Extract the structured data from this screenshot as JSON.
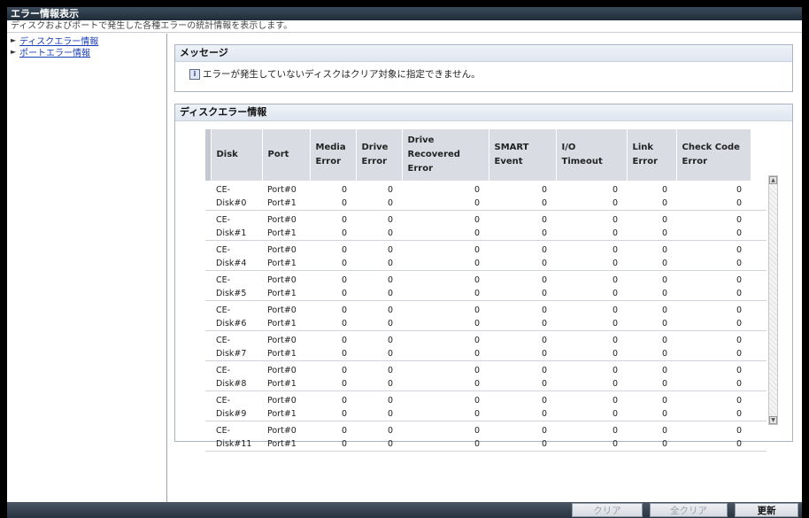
{
  "window": {
    "title": "エラー情報表示",
    "subtitle": "ディスクおよびポートで発生した各種エラーの統計情報を表示します。"
  },
  "sidebar": {
    "items": [
      {
        "label": "ディスクエラー情報"
      },
      {
        "label": "ポートエラー情報"
      }
    ]
  },
  "message_panel": {
    "title": "メッセージ",
    "text": "エラーが発生していないディスクはクリア対象に指定できません。",
    "icon": "info-icon"
  },
  "disk_panel": {
    "title": "ディスクエラー情報",
    "columns": {
      "disk": "Disk",
      "port": "Port",
      "media_error_1": "Media",
      "media_error_2": "Error",
      "drive_error_1": "Drive",
      "drive_error_2": "Error",
      "drive_recovered_1": "Drive",
      "drive_recovered_2": "Recovered",
      "drive_recovered_3": "Error",
      "smart_event_1": "SMART",
      "smart_event_2": "Event",
      "io_timeout_1": "I/O",
      "io_timeout_2": "Timeout",
      "link_error_1": "Link",
      "link_error_2": "Error",
      "check_code_1": "Check Code",
      "check_code_2": "Error"
    },
    "rows": [
      {
        "disk1": "CE-",
        "disk2": "Disk#0",
        "p1": "Port#0",
        "p2": "Port#1",
        "a": [
          "0",
          "0",
          "0",
          "0",
          "0",
          "0",
          "0"
        ],
        "b": [
          "0",
          "0",
          "0",
          "0",
          "0",
          "0",
          "0"
        ]
      },
      {
        "disk1": "CE-",
        "disk2": "Disk#1",
        "p1": "Port#0",
        "p2": "Port#1",
        "a": [
          "0",
          "0",
          "0",
          "0",
          "0",
          "0",
          "0"
        ],
        "b": [
          "0",
          "0",
          "0",
          "0",
          "0",
          "0",
          "0"
        ]
      },
      {
        "disk1": "CE-",
        "disk2": "Disk#4",
        "p1": "Port#0",
        "p2": "Port#1",
        "a": [
          "0",
          "0",
          "0",
          "0",
          "0",
          "0",
          "0"
        ],
        "b": [
          "0",
          "0",
          "0",
          "0",
          "0",
          "0",
          "0"
        ]
      },
      {
        "disk1": "CE-",
        "disk2": "Disk#5",
        "p1": "Port#0",
        "p2": "Port#1",
        "a": [
          "0",
          "0",
          "0",
          "0",
          "0",
          "0",
          "0"
        ],
        "b": [
          "0",
          "0",
          "0",
          "0",
          "0",
          "0",
          "0"
        ]
      },
      {
        "disk1": "CE-",
        "disk2": "Disk#6",
        "p1": "Port#0",
        "p2": "Port#1",
        "a": [
          "0",
          "0",
          "0",
          "0",
          "0",
          "0",
          "0"
        ],
        "b": [
          "0",
          "0",
          "0",
          "0",
          "0",
          "0",
          "0"
        ]
      },
      {
        "disk1": "CE-",
        "disk2": "Disk#7",
        "p1": "Port#0",
        "p2": "Port#1",
        "a": [
          "0",
          "0",
          "0",
          "0",
          "0",
          "0",
          "0"
        ],
        "b": [
          "0",
          "0",
          "0",
          "0",
          "0",
          "0",
          "0"
        ]
      },
      {
        "disk1": "CE-",
        "disk2": "Disk#8",
        "p1": "Port#0",
        "p2": "Port#1",
        "a": [
          "0",
          "0",
          "0",
          "0",
          "0",
          "0",
          "0"
        ],
        "b": [
          "0",
          "0",
          "0",
          "0",
          "0",
          "0",
          "0"
        ]
      },
      {
        "disk1": "CE-",
        "disk2": "Disk#9",
        "p1": "Port#0",
        "p2": "Port#1",
        "a": [
          "0",
          "0",
          "0",
          "0",
          "0",
          "0",
          "0"
        ],
        "b": [
          "0",
          "0",
          "0",
          "0",
          "0",
          "0",
          "0"
        ]
      },
      {
        "disk1": "CE-",
        "disk2": "Disk#11",
        "p1": "Port#0",
        "p2": "Port#1",
        "a": [
          "0",
          "0",
          "0",
          "0",
          "0",
          "0",
          "0"
        ],
        "b": [
          "0",
          "0",
          "0",
          "0",
          "0",
          "0",
          "0"
        ]
      }
    ]
  },
  "footer": {
    "clear_label": "クリア",
    "clear_all_label": "全クリア",
    "refresh_label": "更新"
  }
}
